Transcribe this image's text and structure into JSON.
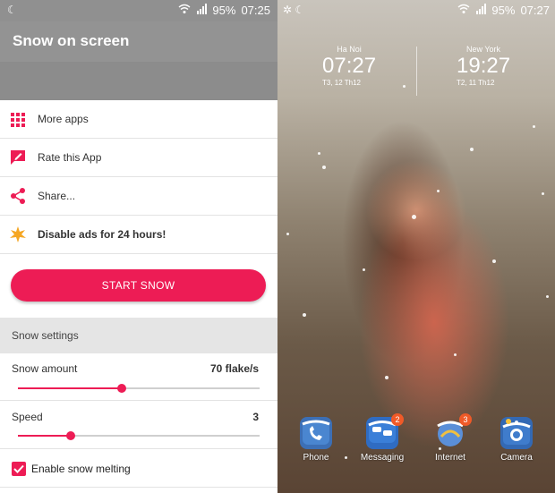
{
  "left_status": {
    "time": "07:25",
    "battery": "95%"
  },
  "appbar": {
    "title": "Snow on screen"
  },
  "menu": {
    "more_apps": "More apps",
    "rate": "Rate this App",
    "share": "Share...",
    "disable_ads": "Disable ads for 24 hours!"
  },
  "start_button": "START SNOW",
  "settings": {
    "header": "Snow settings",
    "amount_label": "Snow amount",
    "amount_value": "70 flake/s",
    "amount_fraction": 0.43,
    "speed_label": "Speed",
    "speed_value": "3",
    "speed_fraction": 0.22,
    "melting_label": "Enable snow melting",
    "melting_checked": true
  },
  "right_status": {
    "time": "07:27",
    "battery": "95%"
  },
  "clocks": [
    {
      "city": "Ha Noi",
      "time": "07:27",
      "date": "T3, 12 Th12"
    },
    {
      "city": "New York",
      "time": "19:27",
      "date": "T2, 11 Th12"
    }
  ],
  "dock": [
    {
      "label": "Phone",
      "icon": "phone-icon"
    },
    {
      "label": "Messaging",
      "icon": "messaging-icon",
      "badge": "2"
    },
    {
      "label": "Internet",
      "icon": "internet-icon",
      "badge": "3"
    },
    {
      "label": "Camera",
      "icon": "camera-icon"
    }
  ],
  "colors": {
    "accent": "#ed1c55",
    "appbar": "#939393"
  }
}
